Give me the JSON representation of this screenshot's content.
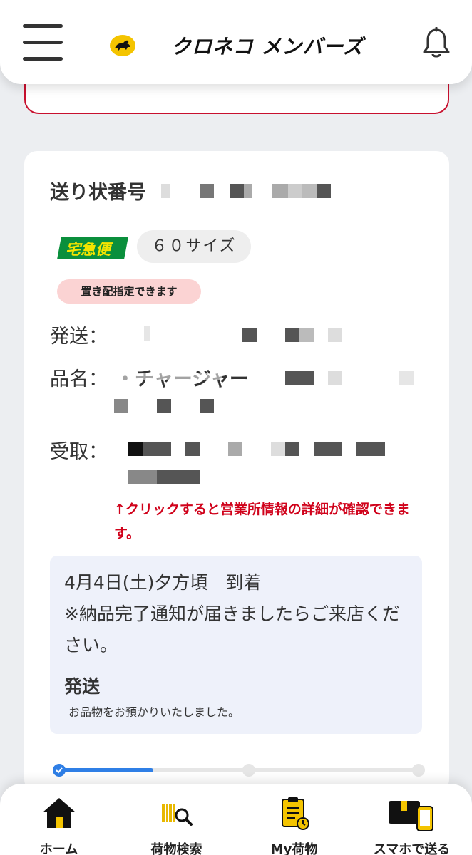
{
  "header": {
    "app_name": "クロネコ メンバーズ"
  },
  "package": {
    "tracking_label": "送り状番号",
    "service_badge": "宅急便",
    "size": "６０サイズ",
    "okihai_badge": "置き配指定できます",
    "sender_label": "発送：",
    "item_label": "品名：",
    "item_visible": "・チャージャー",
    "receiver_label": "受取：",
    "office_hint": "↑クリックすると営業所情報の詳細が確認できます。"
  },
  "delivery": {
    "eta": "4月4日(土)夕方頃　到着",
    "notice": "※納品完了通知が届きましたらご来店ください。",
    "status_title": "発送",
    "status_text": "お品物をお預かりいたしました。",
    "progress": 0.27
  },
  "nav": {
    "items": [
      {
        "label": "ホーム",
        "icon": "home-icon"
      },
      {
        "label": "荷物検索",
        "icon": "barcode-search-icon"
      },
      {
        "label": "My荷物",
        "icon": "clipboard-icon"
      },
      {
        "label": "スマホで送る",
        "icon": "phone-box-icon"
      }
    ]
  },
  "colors": {
    "brand_yellow": "#f4c400",
    "alert_red": "#d0021b",
    "progress_blue": "#2f7fe6"
  }
}
